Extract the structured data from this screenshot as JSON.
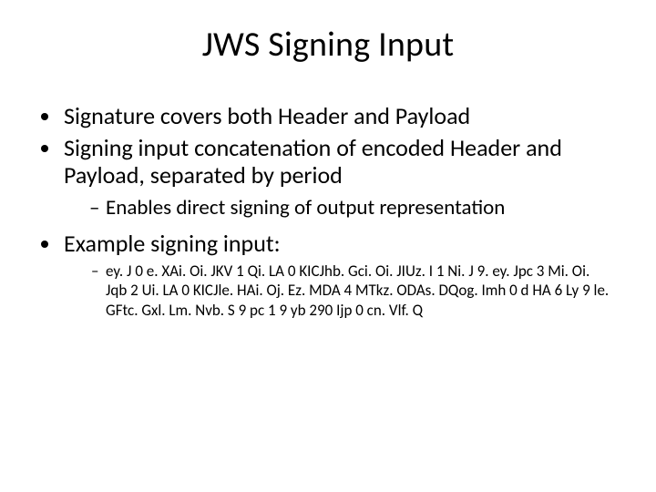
{
  "title": "JWS Signing Input",
  "bullets": {
    "b1": "Signature covers both Header and Payload",
    "b2": "Signing input concatenation of encoded Header and Payload, separated by period",
    "b2_sub1": "Enables direct signing of output representation",
    "b3": "Example signing input:",
    "b3_sub1": "ey. J 0 e. XAi. Oi. JKV 1 Qi. LA 0 KICJhb. Gci. Oi. JIUz. I 1 Ni. J 9. ey. Jpc 3 Mi. Oi. Jqb 2 Ui. LA 0 KICJle. HAi. Oj. Ez. MDA 4 MTkz. ODAs. DQog. Imh 0 d HA 6 Ly 9 le. GFtc. Gxl. Lm. Nvb. S 9 pc 1 9 yb 290 Ijp 0 cn. Vlf. Q"
  }
}
